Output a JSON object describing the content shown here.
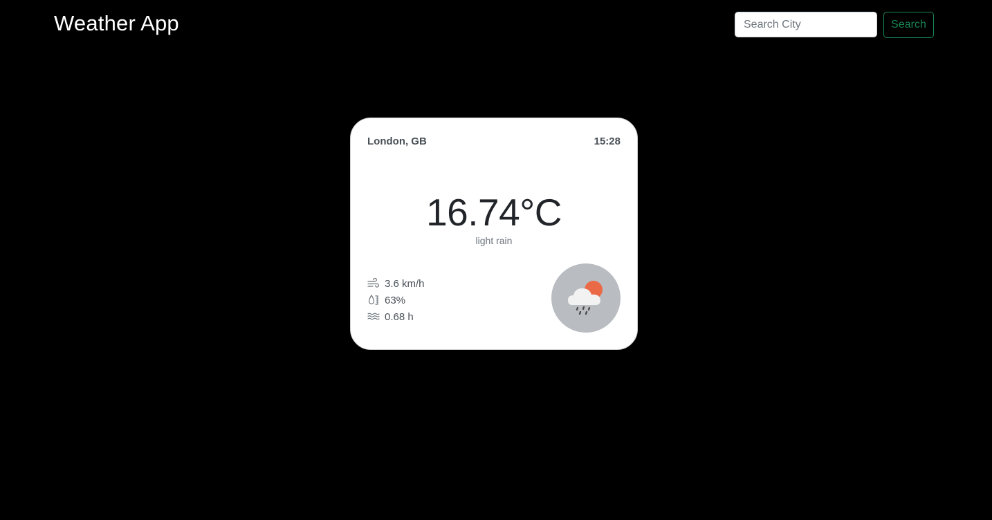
{
  "navbar": {
    "brand": "Weather App",
    "search_placeholder": "Search City",
    "search_label": "Search"
  },
  "card": {
    "location": "London, GB",
    "time": "15:28",
    "temperature": "16.74°C",
    "description": "light rain",
    "wind": "3.6 km/h",
    "humidity": "63%",
    "visibility": "0.68 h",
    "icons": {
      "wind": "wind-icon",
      "humidity": "humidity-icon",
      "visibility": "waves-icon",
      "condition": "rain-cloud-sun-icon"
    }
  },
  "colors": {
    "background": "#000000",
    "accent": "#198754",
    "card": "#ffffff",
    "icon_circle": "#b9bcc0",
    "sun": "#ea6a47"
  }
}
